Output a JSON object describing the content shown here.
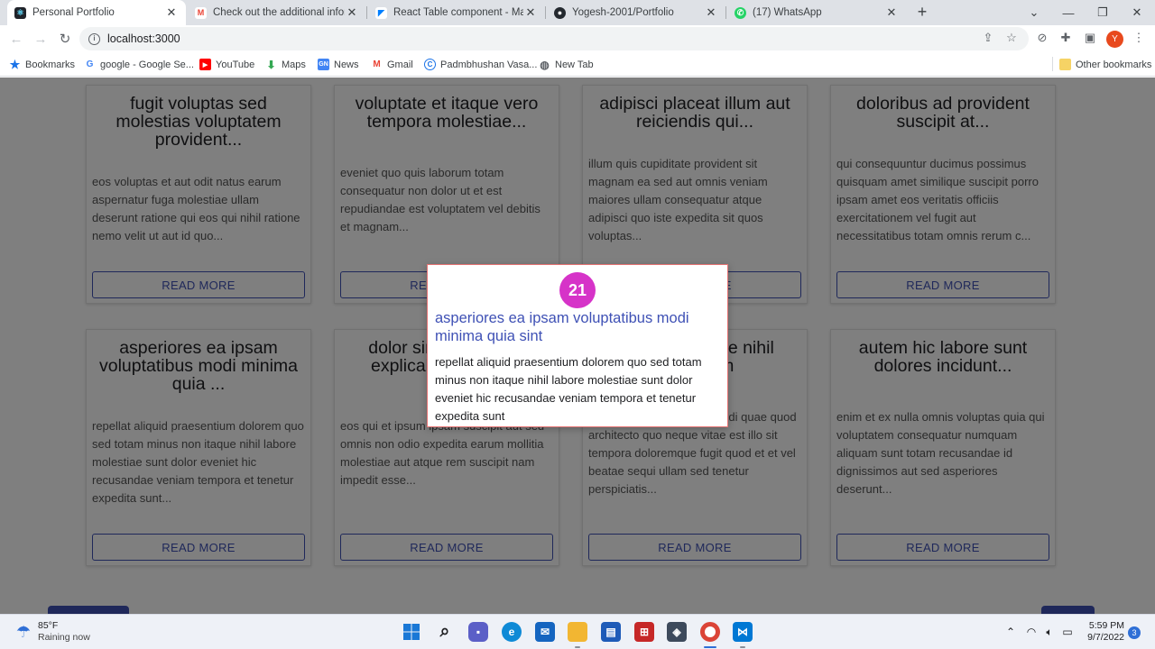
{
  "browser": {
    "tabs": [
      {
        "title": "Personal Portfolio",
        "icon": "react-favicon",
        "active": true
      },
      {
        "title": "Check out the additional informa",
        "icon": "gmail-icon",
        "active": false
      },
      {
        "title": "React Table component - Materia",
        "icon": "mui-icon",
        "active": false
      },
      {
        "title": "Yogesh-2001/Portfolio",
        "icon": "github-icon",
        "active": false
      },
      {
        "title": "(17) WhatsApp",
        "icon": "whatsapp-icon",
        "active": false
      }
    ],
    "address": "localhost:3000",
    "profile_initial": "Y",
    "bookmarks": [
      {
        "label": "Bookmarks",
        "icon": "star-icon"
      },
      {
        "label": "google - Google Se...",
        "icon": "google-icon"
      },
      {
        "label": "YouTube",
        "icon": "youtube-icon"
      },
      {
        "label": "Maps",
        "icon": "maps-icon"
      },
      {
        "label": "News",
        "icon": "news-icon"
      },
      {
        "label": "Gmail",
        "icon": "gmail-icon"
      },
      {
        "label": "Padmbhushan Vasa...",
        "icon": "c-icon"
      },
      {
        "label": "New Tab",
        "icon": "globe-icon"
      }
    ],
    "other_bookmarks": "Other bookmarks"
  },
  "cards": [
    {
      "title": "fugit voluptas sed molestias voluptatem provident...",
      "body": "eos voluptas et aut odit natus earum aspernatur fuga molestiae ullam deserunt ratione qui eos qui nihil ratione nemo velit ut aut id quo...",
      "button": "READ MORE"
    },
    {
      "title": "voluptate et itaque vero tempora molestiae...",
      "body": "eveniet quo quis laborum totam consequatur non dolor ut et est repudiandae est voluptatem vel debitis et magnam...",
      "button": "READ MORE"
    },
    {
      "title": "adipisci placeat illum aut reiciendis qui...",
      "body": "illum quis cupiditate provident sit magnam ea sed aut omnis veniam maiores ullam consequatur atque adipisci quo iste expedita sit quos voluptas...",
      "button": "READ MORE"
    },
    {
      "title": "doloribus ad provident suscipit at...",
      "body": "qui consequuntur ducimus possimus quisquam amet similique suscipit porro ipsam amet eos veritatis officiis exercitationem vel fugit aut necessitatibus totam omnis rerum c...",
      "button": "READ MORE"
    },
    {
      "title": "asperiores ea ipsam voluptatibus modi minima quia ...",
      "body": "repellat aliquid praesentium dolorem quo sed totam minus non itaque nihil labore molestiae sunt dolor eveniet hic recusandae veniam tempora et tenetur expedita sunt...",
      "button": "READ MORE"
    },
    {
      "title": "dolor sint quo a velit explicabo quia nam",
      "body": "eos qui et ipsum ipsam suscipit aut sed omnis non odio expedita earum mollitia molestiae aut atque rem suscipit nam impedit esse...",
      "button": "READ MORE"
    },
    {
      "title": "maxime id vitae nihil numquam",
      "body": "veritatis unde neque eligendi quae quod architecto quo neque vitae est illo sit tempora doloremque fugit quod et et vel beatae sequi ullam sed tenetur perspiciatis...",
      "button": "READ MORE"
    },
    {
      "title": "autem hic labore sunt dolores incidunt...",
      "body": "enim et ex nulla omnis voluptas quia qui voluptatem consequatur numquam aliquam sunt totam recusandae id dignissimos aut sed asperiores deserunt...",
      "button": "READ MORE"
    }
  ],
  "popover": {
    "badge": "21",
    "title": "asperiores ea ipsam voluptatibus modi minima quia sint",
    "body": "repellat aliquid praesentium dolorem quo sed totam minus non itaque nihil labore molestiae sunt dolor eveniet hic recusandae veniam tempora et tenetur expedita sunt"
  },
  "taskbar": {
    "weather_temp": "85°F",
    "weather_desc": "Raining now",
    "time": "5:59 PM",
    "date": "9/7/2022",
    "notifications": "3"
  },
  "colors": {
    "accent": "#3f51b5",
    "badge": "#d633c8",
    "popover_border": "#e57373"
  }
}
